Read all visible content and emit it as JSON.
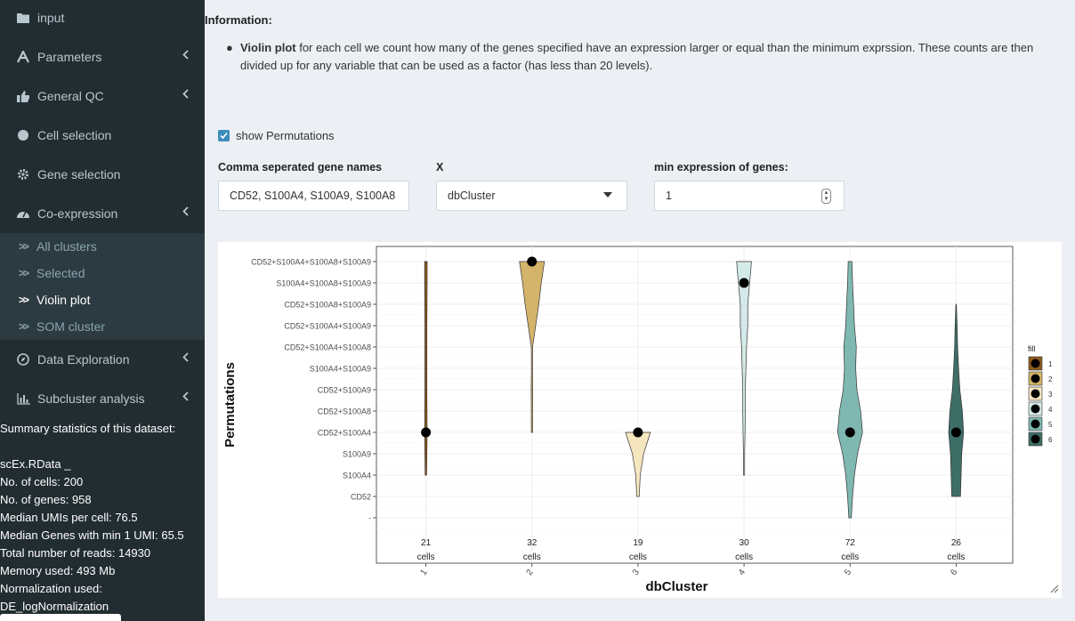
{
  "sidebar": {
    "items": [
      {
        "label": "input",
        "icon": "folder-icon",
        "chevron": false
      },
      {
        "label": "Parameters",
        "icon": "wizard-icon",
        "chevron": true
      },
      {
        "label": "General QC",
        "icon": "thumbs-up-icon",
        "chevron": true
      },
      {
        "label": "Cell selection",
        "icon": "circle-icon",
        "chevron": false
      },
      {
        "label": "Gene selection",
        "icon": "cog-icon",
        "chevron": false
      },
      {
        "label": "Co-expression",
        "icon": "dashboard-icon",
        "chevron": true
      }
    ],
    "subitems": [
      {
        "label": "All clusters",
        "active": false
      },
      {
        "label": "Selected",
        "active": false
      },
      {
        "label": "Violin plot",
        "active": true
      },
      {
        "label": "SOM cluster",
        "active": false
      }
    ],
    "items2": [
      {
        "label": "Data Exploration",
        "icon": "compass-icon",
        "chevron": true
      },
      {
        "label": "Subcluster analysis",
        "icon": "bar-chart-icon",
        "chevron": true
      }
    ],
    "summary_title": "Summary statistics of this dataset:",
    "summary_lines": [
      "scEx.RData _",
      "No. of cells: 200",
      "No. of genes: 958",
      "Median UMIs per cell: 76.5",
      "Median Genes with min 1 UMI: 65.5",
      "Total number of reads: 14930",
      "Memory used: 493 Mb",
      "Normalization used:",
      "DE_logNormalization"
    ]
  },
  "info": {
    "title": "Information:",
    "bold": "Violin plot",
    "text": " for each cell we count how many of the genes specified have an expression larger or equal than the minimum exprssion. These counts are then divided up for any variable that can be used as a factor (has less than 20 levels)."
  },
  "controls": {
    "show_permutations_label": "show Permutations",
    "show_permutations_checked": true,
    "genes_label": "Comma seperated gene names",
    "genes_value": "CD52, S100A4, S100A9, S100A8",
    "x_label": "X",
    "x_value": "dbCluster",
    "minexpr_label": "min expression of genes:",
    "minexpr_value": "1"
  },
  "chart_data": {
    "type": "violin",
    "xlabel": "dbCluster",
    "ylabel": "Permutations",
    "y_categories": [
      "-",
      "CD52",
      "S100A4",
      "S100A9",
      "CD52+S100A4",
      "CD52+S100A8",
      "CD52+S100A9",
      "S100A4+S100A9",
      "CD52+S100A4+S100A8",
      "CD52+S100A4+S100A9",
      "CD52+S100A8+S100A9",
      "S100A4+S100A8+S100A9",
      "CD52+S100A4+S100A8+S100A9"
    ],
    "categories": [
      "1",
      "2",
      "3",
      "4",
      "5",
      "6"
    ],
    "counts": [
      "21",
      "32",
      "19",
      "30",
      "72",
      "26"
    ],
    "count_unit": "cells",
    "medians": [
      "CD52+S100A4",
      "CD52+S100A4+S100A8+S100A9",
      "CD52+S100A4",
      "S100A4+S100A8+S100A9",
      "CD52+S100A4",
      "CD52+S100A4"
    ],
    "ranges": [
      [
        "S100A4",
        "CD52+S100A4+S100A8+S100A9"
      ],
      [
        "CD52+S100A4",
        "CD52+S100A4+S100A8+S100A9"
      ],
      [
        "CD52",
        "CD52+S100A4"
      ],
      [
        "S100A4",
        "CD52+S100A4+S100A8+S100A9"
      ],
      [
        "-",
        "CD52+S100A4+S100A8+S100A9"
      ],
      [
        "CD52",
        "CD52+S100A8+S100A9"
      ]
    ],
    "legend": {
      "title": "fill",
      "entries": [
        "1",
        "2",
        "3",
        "4",
        "5",
        "6"
      ],
      "colors": [
        "#8c5a1f",
        "#d4b46a",
        "#f5e6c0",
        "#d4eae8",
        "#7fb8b0",
        "#3e6e66"
      ]
    },
    "legend_position": "right",
    "grid": true
  }
}
